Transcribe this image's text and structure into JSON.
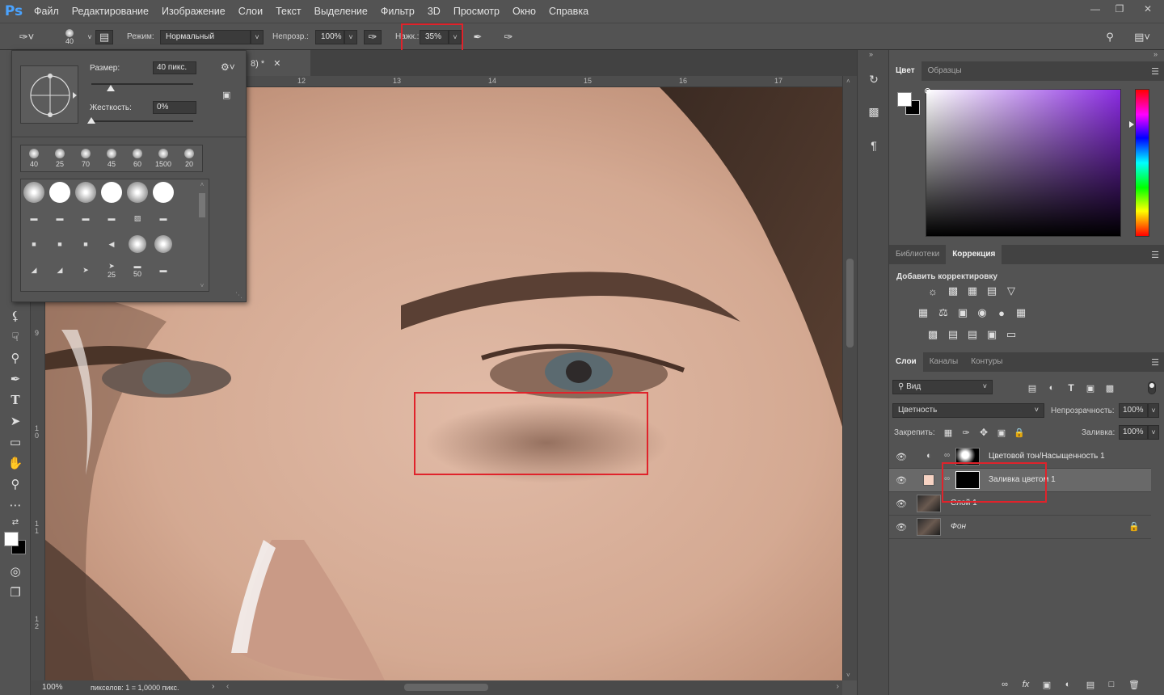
{
  "app": {
    "logo": "Ps"
  },
  "menu": [
    "Файл",
    "Редактирование",
    "Изображение",
    "Слои",
    "Текст",
    "Выделение",
    "Фильтр",
    "3D",
    "Просмотр",
    "Окно",
    "Справка"
  ],
  "window_controls": [
    "minimize-icon",
    "restore-icon",
    "close-icon"
  ],
  "options": {
    "brush_size_value": "40",
    "mode_label": "Режим:",
    "mode_value": "Нормальный",
    "opacity_label": "Непрозр.:",
    "opacity_value": "100%",
    "flow_label": "Нажк.:",
    "flow_value": "35%"
  },
  "brush_popup": {
    "size_label": "Размер:",
    "size_value": "40 пикс.",
    "size_slider_fraction": 0.19,
    "hardness_label": "Жесткость:",
    "hardness_value": "0%",
    "hardness_slider_fraction": 0.0,
    "presets": [
      "40",
      "25",
      "70",
      "45",
      "60",
      "1500",
      "20"
    ],
    "grid_labels": [
      "25",
      "50"
    ]
  },
  "document": {
    "tab_title": "8) *",
    "ruler_h": [
      "12",
      "13",
      "14",
      "15",
      "16",
      "17"
    ],
    "ruler_v": [
      "9",
      "1 0",
      "1 1",
      "1 2"
    ],
    "zoom": "100%",
    "status": "пикселов: 1 = 1,0000 пикс."
  },
  "color_panel": {
    "tabs": [
      "Цвет",
      "Образцы"
    ],
    "active_tab": 0,
    "hue_color": "#8a2be2",
    "foreground": "#ffffff",
    "background": "#000000"
  },
  "adjust_panel": {
    "tabs": [
      "Библиотеки",
      "Коррекция"
    ],
    "active_tab": 1,
    "title": "Добавить корректировку"
  },
  "layers_panel": {
    "tabs": [
      "Слои",
      "Каналы",
      "Контуры"
    ],
    "active_tab": 0,
    "filter_kind": "Вид",
    "blend_mode": "Цветность",
    "opacity_label": "Непрозрачность:",
    "opacity_value": "100%",
    "lock_label": "Закрепить:",
    "fill_label": "Заливка:",
    "fill_value": "100%",
    "layers": [
      {
        "name": "Цветовой тон/Насыщенность 1",
        "type": "adjustment"
      },
      {
        "name": "Заливка цветом 1",
        "type": "fill",
        "swatch": "#f7d3c3",
        "selected": true
      },
      {
        "name": "Слой 1",
        "type": "pixel"
      },
      {
        "name": "Фон",
        "type": "background",
        "locked": true
      }
    ]
  },
  "colors": {
    "highlight": "#e0232b",
    "selection_row": "#696969"
  }
}
